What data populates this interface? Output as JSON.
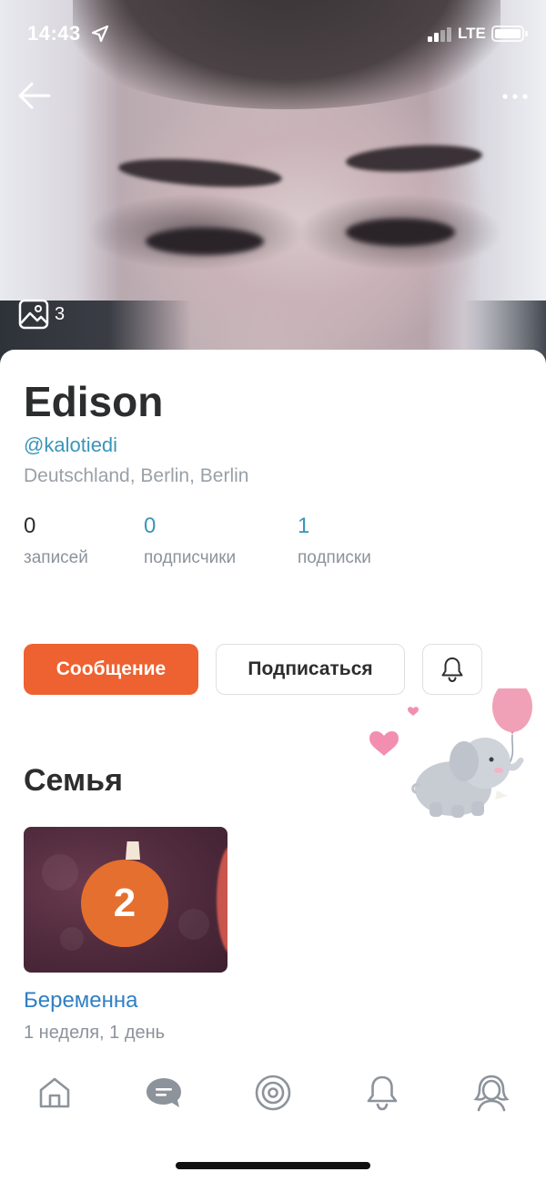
{
  "status_bar": {
    "time": "14:43",
    "network": "LTE"
  },
  "header": {
    "photo_count": "3"
  },
  "profile": {
    "name": "Edison",
    "handle": "@kalotiedi",
    "location": "Deutschland, Berlin, Berlin"
  },
  "stats": [
    {
      "value": "0",
      "label": "записей"
    },
    {
      "value": "0",
      "label": "подписчики"
    },
    {
      "value": "1",
      "label": "подписки"
    }
  ],
  "actions": {
    "message_label": "Сообщение",
    "follow_label": "Подписаться"
  },
  "family": {
    "title": "Семья",
    "pregnancy": {
      "badge": "2",
      "title": "Беременна",
      "duration": "1 неделя, 1 день"
    }
  },
  "colors": {
    "accent": "#ee6130",
    "link": "#3a95b8",
    "tab_icon": "#8d939b"
  }
}
